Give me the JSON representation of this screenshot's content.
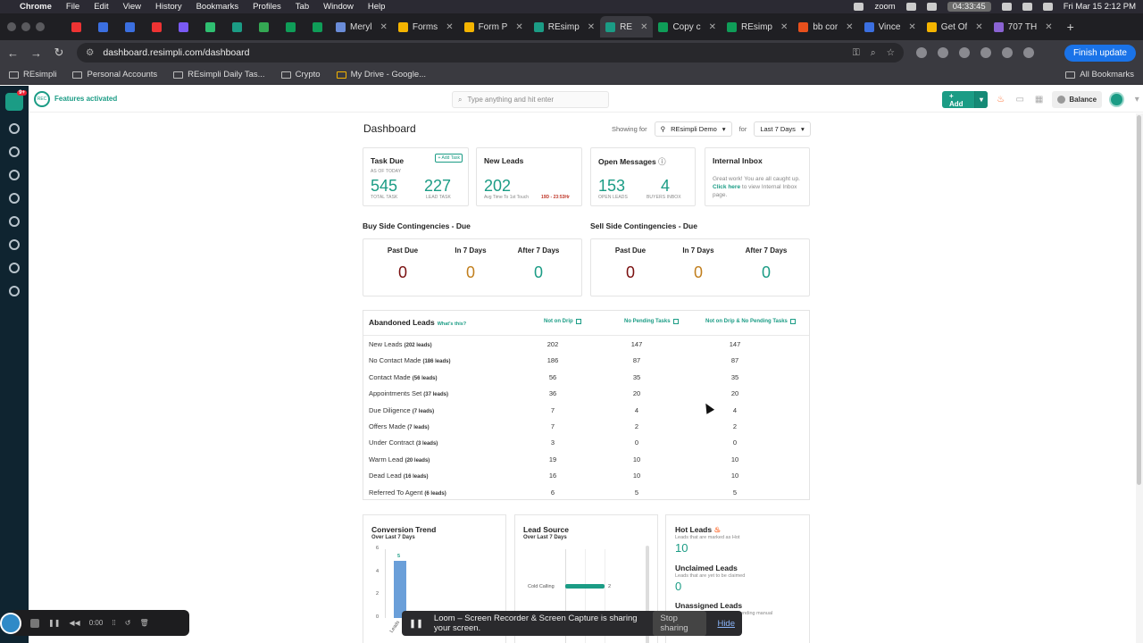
{
  "menubar": {
    "app": "Chrome",
    "items": [
      "File",
      "Edit",
      "View",
      "History",
      "Bookmarks",
      "Profiles",
      "Tab",
      "Window",
      "Help"
    ],
    "zoom": "zoom",
    "timer": "04:33:45",
    "datetime": "Fri Mar 15  2:12 PM"
  },
  "tabs": [
    {
      "title": "Meryl",
      "color": "#6a8cd8"
    },
    {
      "title": "Forms",
      "color": "#f4b400"
    },
    {
      "title": "Form P",
      "color": "#f4b400"
    },
    {
      "title": "REsimp",
      "color": "#1b9c85"
    },
    {
      "title": "RE",
      "color": "#1b9c85",
      "active": true
    },
    {
      "title": "Copy c",
      "color": "#0f9d58"
    },
    {
      "title": "REsimp",
      "color": "#0f9d58"
    },
    {
      "title": "bb cor",
      "color": "#e8501c"
    },
    {
      "title": "Vince",
      "color": "#3b6fe0"
    },
    {
      "title": "Get Of",
      "color": "#f4b400"
    },
    {
      "title": "707 TH",
      "color": "#8a63d2"
    }
  ],
  "pinned_tab_colors": [
    "#e33",
    "#3b6fe0",
    "#3b6fe0",
    "#e33",
    "#7a5af5",
    "#2fbf71",
    "#1b9c85",
    "#34a853",
    "#0f9d58",
    "#0f9d58"
  ],
  "toolbar": {
    "url": "dashboard.resimpli.com/dashboard",
    "finish_update": "Finish update"
  },
  "bookmarks": {
    "items": [
      "REsimpli",
      "Personal Accounts",
      "REsimpli Daily Tas...",
      "Crypto",
      "My Drive - Google..."
    ],
    "all": "All Bookmarks"
  },
  "header": {
    "badge": "REC",
    "features": "Features activated",
    "search_placeholder": "Type anything and hit enter",
    "add": "Add",
    "balance": "Balance"
  },
  "dashboard": {
    "title": "Dashboard",
    "showing_for": "Showing for",
    "account": "REsimpli Demo",
    "for": "for",
    "range": "Last 7 Days"
  },
  "cards": {
    "task_due": {
      "title": "Task Due",
      "add_task": "+ Add Task",
      "as_of": "AS OF TODAY",
      "total": "545",
      "total_label": "TOTAL TASK",
      "lead": "227",
      "lead_label": "LEAD TASK"
    },
    "new_leads": {
      "title": "New Leads",
      "value": "202",
      "caption": "Avg Time To 1st Touch",
      "time": "19D - 23:53Hr"
    },
    "open_messages": {
      "title": "Open Messages",
      "open": "153",
      "open_label": "OPEN LEADS",
      "buyers": "4",
      "buyers_label": "BUYERS INBOX"
    },
    "internal_inbox": {
      "title": "Internal Inbox",
      "text1": "Great work! You are all caught up.",
      "link": "Click here",
      "text2": "to view Internal Inbox page."
    }
  },
  "contingencies": {
    "buy_title": "Buy Side Contingencies - Due",
    "sell_title": "Sell Side Contingencies - Due",
    "labels": [
      "Past Due",
      "In 7 Days",
      "After 7 Days"
    ],
    "buy_values": [
      "0",
      "0",
      "0"
    ],
    "sell_values": [
      "0",
      "0",
      "0"
    ]
  },
  "abandoned": {
    "title": "Abandoned Leads",
    "whats_this": "What's this?",
    "columns": [
      "Not on Drip",
      "No Pending Tasks",
      "Not on Drip & No Pending Tasks"
    ],
    "rows": [
      {
        "name": "New Leads",
        "count": "(202 leads)",
        "vals": [
          "202",
          "147",
          "147"
        ]
      },
      {
        "name": "No Contact Made",
        "count": "(186 leads)",
        "vals": [
          "186",
          "87",
          "87"
        ]
      },
      {
        "name": "Contact Made",
        "count": "(56 leads)",
        "vals": [
          "56",
          "35",
          "35"
        ]
      },
      {
        "name": "Appointments Set",
        "count": "(37 leads)",
        "vals": [
          "36",
          "20",
          "20"
        ]
      },
      {
        "name": "Due Diligence",
        "count": "(7 leads)",
        "vals": [
          "7",
          "4",
          "4"
        ]
      },
      {
        "name": "Offers Made",
        "count": "(7 leads)",
        "vals": [
          "7",
          "2",
          "2"
        ]
      },
      {
        "name": "Under Contract",
        "count": "(3 leads)",
        "vals": [
          "3",
          "0",
          "0"
        ]
      },
      {
        "name": "Warm Lead",
        "count": "(20 leads)",
        "vals": [
          "19",
          "10",
          "10"
        ]
      },
      {
        "name": "Dead Lead",
        "count": "(16 leads)",
        "vals": [
          "16",
          "10",
          "10"
        ]
      },
      {
        "name": "Referred To Agent",
        "count": "(6 leads)",
        "vals": [
          "6",
          "5",
          "5"
        ]
      }
    ]
  },
  "conversion": {
    "title": "Conversion Trend",
    "sub": "Over Last 7 Days",
    "ticks": [
      "6",
      "4",
      "2",
      "0"
    ],
    "bar_label": "5",
    "x_label": "Leads"
  },
  "lead_source": {
    "title": "Lead Source",
    "sub": "Over Last 7 Days",
    "label": "Cold Calling",
    "value": "2"
  },
  "hot_panel": {
    "hot": "Hot Leads",
    "hot_sub": "Leads that are marked as Hot",
    "hot_val": "10",
    "unclaimed": "Unclaimed Leads",
    "unclaimed_sub": "Leads that are yet to be claimed",
    "unclaimed_val": "0",
    "unassigned": "Unassigned Leads",
    "unassigned_sub": "pending manual"
  },
  "chart_data": [
    {
      "type": "bar",
      "title": "Conversion Trend",
      "subtitle": "Over Last 7 Days",
      "categories": [
        "Leads"
      ],
      "values": [
        5
      ],
      "ylim": [
        0,
        6
      ]
    },
    {
      "type": "bar",
      "title": "Lead Source",
      "subtitle": "Over Last 7 Days",
      "categories": [
        "Cold Calling"
      ],
      "values": [
        2
      ],
      "orientation": "horizontal"
    }
  ],
  "loom": {
    "time": "0:00",
    "share_text": "Loom – Screen Recorder & Screen Capture is sharing your screen.",
    "stop": "Stop sharing",
    "hide": "Hide"
  }
}
